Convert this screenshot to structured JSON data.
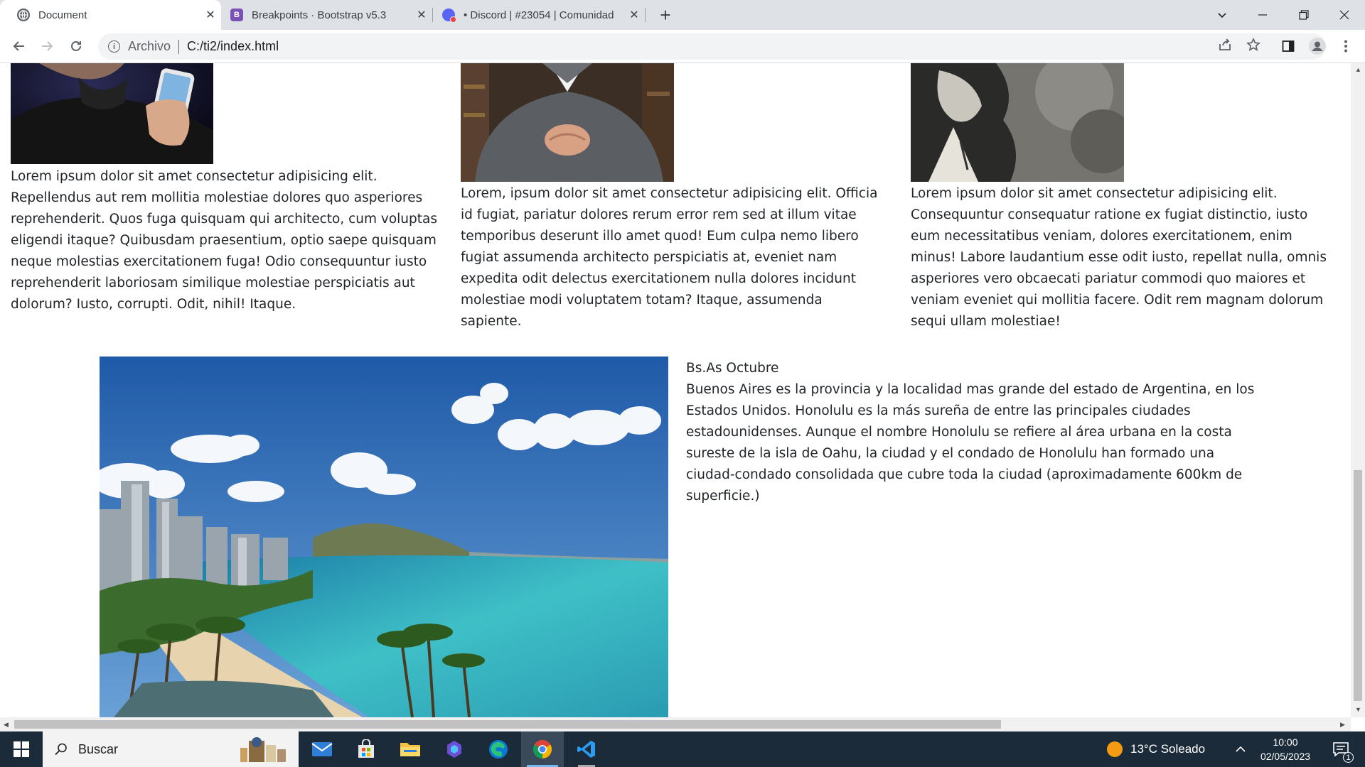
{
  "browser": {
    "tabs": [
      {
        "title": "Document",
        "active": true,
        "close": "✕"
      },
      {
        "title": "Breakpoints · Bootstrap v5.3",
        "favicon_letter": "B",
        "close": "✕"
      },
      {
        "title": "• Discord | #23054 | Comunidad",
        "close": "✕"
      }
    ],
    "new_tab": "+",
    "address": {
      "security_label": "Archivo",
      "url": "C:/ti2/index.html"
    }
  },
  "page": {
    "columns": [
      {
        "text": "Lorem ipsum dolor sit amet consectetur adipisicing elit. Repellendus aut rem mollitia molestiae dolores quo asperiores reprehenderit. Quos fuga quisquam qui architecto, cum voluptas eligendi itaque? Quibusdam praesentium, optio saepe quisquam neque molestias exercitationem fuga! Odio consequuntur iusto reprehenderit laboriosam similique molestiae perspiciatis aut dolorum? Iusto, corrupti. Odit, nihil! Itaque."
      },
      {
        "text": "Lorem, ipsum dolor sit amet consectetur adipisicing elit. Officia id fugiat, pariatur dolores rerum error rem sed at illum vitae temporibus deserunt illo amet quod! Eum culpa nemo libero fugiat assumenda architecto perspiciatis at, eveniet nam expedita odit delectus exercitationem nulla dolores incidunt molestiae modi voluptatem totam? Itaque, assumenda sapiente."
      },
      {
        "text": "Lorem ipsum dolor sit amet consectetur adipisicing elit. Consequuntur consequatur ratione ex fugiat distinctio, iusto eum necessitatibus veniam, dolores exercitationem, enim minus! Labore laudantium esse odit iusto, repellat nulla, omnis asperiores vero obcaecati pariatur commodi quo maiores et veniam eveniet qui mollitia facere. Odit rem magnam dolorum sequi ullam molestiae!"
      }
    ],
    "feature": {
      "title": "Bs.As Octubre",
      "text": "Buenos Aires es la provincia y la localidad mas grande del estado de Argentina, en los Estados Unidos. Honolulu es la más sureña de entre las principales ciudades estadounidenses. Aunque el nombre Honolulu se refiere al área urbana en la costa sureste de la isla de Oahu, la ciudad y el condado de Honolulu han formado una ciudad-condado consolidada que cubre toda la ciudad (aproximadamente 600km de superficie.)"
    }
  },
  "taskbar": {
    "search_placeholder": "Buscar",
    "weather": "13°C  Soleado",
    "time": "10:00",
    "date": "02/05/2023",
    "notification_count": "1"
  }
}
